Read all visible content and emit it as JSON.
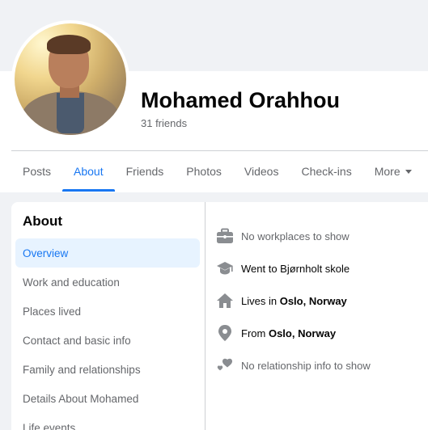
{
  "profile": {
    "name": "Mohamed Orahhou",
    "friends": "31 friends"
  },
  "tabs": [
    {
      "label": "Posts"
    },
    {
      "label": "About"
    },
    {
      "label": "Friends"
    },
    {
      "label": "Photos"
    },
    {
      "label": "Videos"
    },
    {
      "label": "Check-ins"
    },
    {
      "label": "More"
    }
  ],
  "about": {
    "title": "About",
    "nav": [
      {
        "label": "Overview"
      },
      {
        "label": "Work and education"
      },
      {
        "label": "Places lived"
      },
      {
        "label": "Contact and basic info"
      },
      {
        "label": "Family and relationships"
      },
      {
        "label": "Details About Mohamed"
      },
      {
        "label": "Life events"
      }
    ]
  },
  "overview": {
    "work": "No workplaces to show",
    "education": "Went to Bjørnholt skole",
    "lives_prefix": "Lives in ",
    "lives_place": "Oslo, Norway",
    "from_prefix": "From ",
    "from_place": "Oslo, Norway",
    "relationship": "No relationship info to show"
  },
  "colors": {
    "accent": "#1877f2",
    "muted": "#65676b",
    "icon": "#8a8d91"
  }
}
